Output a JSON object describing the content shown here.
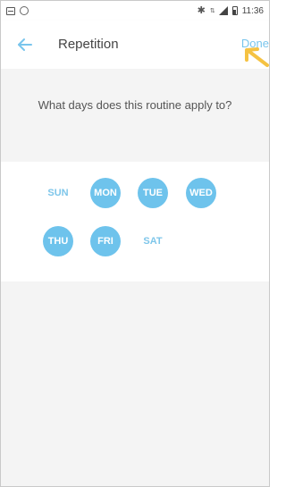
{
  "status_bar": {
    "time": "11:36",
    "icons": [
      "image-icon",
      "alarm-icon",
      "bluetooth-icon",
      "data-icon",
      "signal-icon",
      "battery-icon"
    ]
  },
  "app_bar": {
    "title": "Repetition",
    "done_label": "Done",
    "back_icon": "arrow-left-icon",
    "accent_color": "#79c5ec"
  },
  "question": {
    "text": "What days does this routine apply to?"
  },
  "days": [
    {
      "label": "SUN",
      "selected": false
    },
    {
      "label": "MON",
      "selected": true
    },
    {
      "label": "TUE",
      "selected": true
    },
    {
      "label": "WED",
      "selected": true
    },
    {
      "label": "THU",
      "selected": true
    },
    {
      "label": "FRI",
      "selected": true
    },
    {
      "label": "SAT",
      "selected": false
    }
  ],
  "colors": {
    "selected_day_bg": "#6ec3ec",
    "unselected_day_text": "#7ec6ea",
    "pointer_arrow": "#f5c242"
  }
}
